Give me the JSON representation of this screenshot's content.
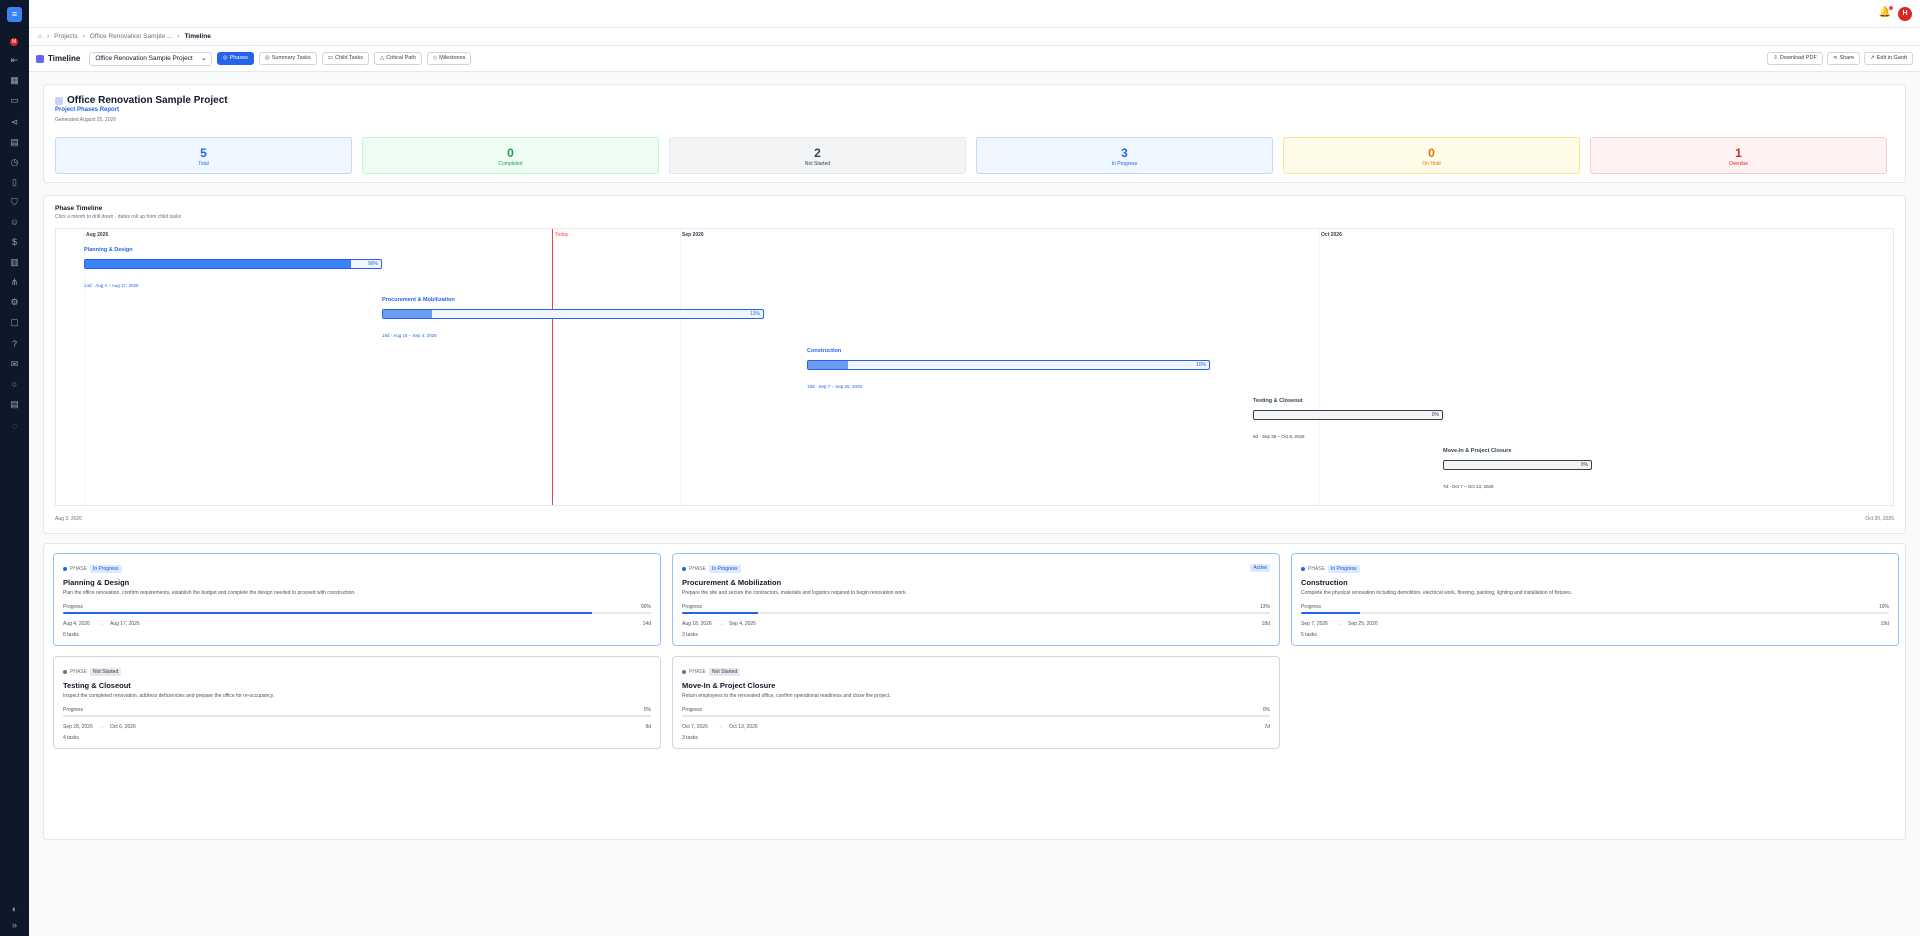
{
  "sidebar": {
    "logo": "≡",
    "notification_badge": "M",
    "icons": [
      "collapse-icon",
      "dashboard-icon",
      "folder-icon",
      "share-icon",
      "calendar-icon",
      "clock-icon",
      "clipboard-icon",
      "shield-icon",
      "users-icon",
      "dollar-icon",
      "chart-icon",
      "network-icon",
      "gear-icon",
      "book-icon",
      "help-icon",
      "mail-icon",
      "circle-icon",
      "file-icon",
      "chat-icon",
      "theme-icon",
      "expand-icon"
    ]
  },
  "topbar": {
    "avatar_initial": "H"
  },
  "breadcrumb": {
    "items": [
      "Projects",
      "Office Renovation Sample ..."
    ],
    "current": "Timeline"
  },
  "toolbar": {
    "title": "Timeline",
    "project_select": "Office Renovation Sample Project",
    "views": [
      "Phases",
      "Summary Tasks",
      "Child Tasks",
      "Critical Path",
      "Milestones"
    ],
    "active_view": "Phases",
    "actions": [
      "Download PDF",
      "Share",
      "Edit in Gantt"
    ]
  },
  "project": {
    "name": "Office Renovation Sample Project",
    "report_label": "Project Phases Report",
    "generated": "Generated August 25, 2026"
  },
  "stats": [
    {
      "value": "5",
      "label": "Total",
      "color": "#2563eb",
      "bg": "#eff6ff",
      "border": "#bfdbfe"
    },
    {
      "value": "0",
      "label": "Completed",
      "color": "#16a34a",
      "bg": "#f0fdf4",
      "border": "#bbf7d0"
    },
    {
      "value": "2",
      "label": "Not Started",
      "color": "#374151",
      "bg": "#f3f4f6",
      "border": "#e5e7eb"
    },
    {
      "value": "3",
      "label": "In Progress",
      "color": "#2563eb",
      "bg": "#eff6ff",
      "border": "#bfdbfe"
    },
    {
      "value": "0",
      "label": "On Hold",
      "color": "#d97706",
      "bg": "#fefce8",
      "border": "#fde68a"
    },
    {
      "value": "1",
      "label": "Overdue",
      "color": "#dc2626",
      "bg": "#fef2f2",
      "border": "#fecaca"
    }
  ],
  "timeline": {
    "heading": "Phase Timeline",
    "subheading": "Click a month to drill down · dates roll up from child tasks",
    "months": [
      "Aug 2026",
      "Sep 2026",
      "Oct 2026"
    ],
    "today_label": "Today",
    "range_start": "Aug 3, 2026",
    "range_end": "Oct 20, 2026",
    "phases": [
      {
        "name": "Planning & Design",
        "progress": 90,
        "pct_label": "90%",
        "dates": "14d · Aug 4 – Aug 17, 2026",
        "color": "#2563eb"
      },
      {
        "name": "Procurement & Mobilization",
        "progress": 13,
        "pct_label": "13%",
        "dates": "18d · Aug 18 – Sep 4, 2026",
        "color": "#2563eb"
      },
      {
        "name": "Construction",
        "progress": 10,
        "pct_label": "10%",
        "dates": "19d · Sep 7 – Sep 25, 2026",
        "color": "#2563eb"
      },
      {
        "name": "Testing & Closeout",
        "progress": 0,
        "pct_label": "0%",
        "dates": "9d · Sep 28 – Oct 6, 2026",
        "color": "#374151"
      },
      {
        "name": "Move-In & Project Closure",
        "progress": 0,
        "pct_label": "0%",
        "dates": "7d · Oct 7 – Oct 13, 2026",
        "color": "#374151"
      }
    ]
  },
  "phase_cards": [
    {
      "kind": "PHASE",
      "status": "In Progress",
      "title": "Planning & Design",
      "desc": "Plan the office renovation, confirm requirements, establish the budget and complete the design needed to proceed with construction.",
      "progress_label": "Progress",
      "pct": "90%",
      "progress": 90,
      "start": "Aug 4, 2026",
      "end": "Aug 17, 2026",
      "duration": "14d",
      "tasks": "6 tasks"
    },
    {
      "kind": "PHASE",
      "status": "In Progress",
      "active": "Active",
      "title": "Procurement & Mobilization",
      "desc": "Prepare the site and secure the contractors, materials and logistics required to begin renovation work.",
      "progress_label": "Progress",
      "pct": "13%",
      "progress": 13,
      "start": "Aug 18, 2026",
      "end": "Sep 4, 2026",
      "duration": "18d",
      "tasks": "3 tasks"
    },
    {
      "kind": "PHASE",
      "status": "In Progress",
      "title": "Construction",
      "desc": "Complete the physical renovation including demolition, electrical work, flooring, painting, lighting and installation of fixtures.",
      "progress_label": "Progress",
      "pct": "10%",
      "progress": 10,
      "start": "Sep 7, 2026",
      "end": "Sep 25, 2026",
      "duration": "19d",
      "tasks": "5 tasks"
    },
    {
      "kind": "PHASE",
      "status": "Not Started",
      "title": "Testing & Closeout",
      "desc": "Inspect the completed renovation, address deficiencies and prepare the office for re-occupancy.",
      "progress_label": "Progress",
      "pct": "0%",
      "progress": 0,
      "start": "Sep 28, 2026",
      "end": "Oct 6, 2026",
      "duration": "9d",
      "tasks": "4 tasks"
    },
    {
      "kind": "PHASE",
      "status": "Not Started",
      "title": "Move-In & Project Closure",
      "desc": "Return employees to the renovated office, confirm operational readiness and close the project.",
      "progress_label": "Progress",
      "pct": "0%",
      "progress": 0,
      "start": "Oct 7, 2026",
      "end": "Oct 13, 2026",
      "duration": "7d",
      "tasks": "3 tasks"
    }
  ]
}
